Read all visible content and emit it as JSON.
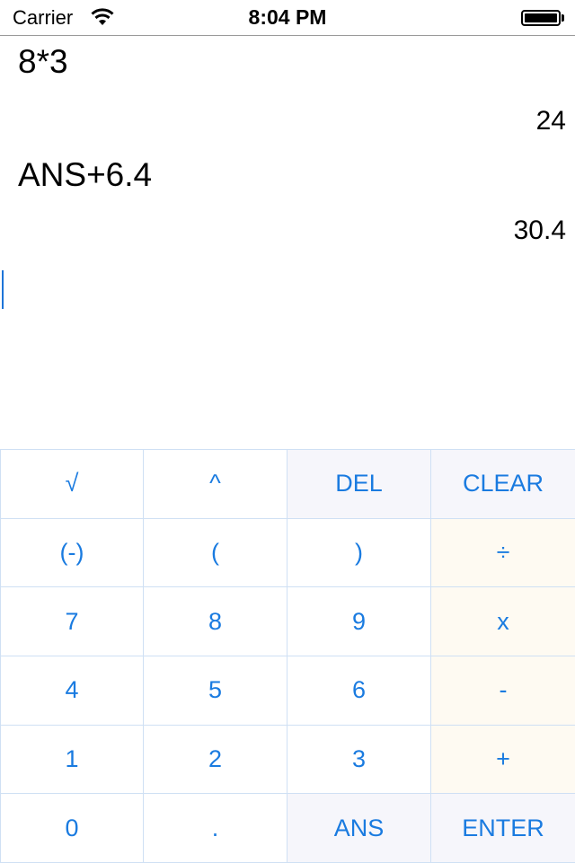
{
  "status_bar": {
    "carrier": "Carrier",
    "time": "8:04 PM",
    "battery_level": 1.0
  },
  "history": [
    {
      "expression": "8*3",
      "result": "24"
    },
    {
      "expression": "ANS+6.4",
      "result": "30.4"
    }
  ],
  "input": {
    "value": ""
  },
  "keypad": {
    "accent_color": "#1a7be0",
    "rows": [
      [
        {
          "label": "√",
          "style": "white"
        },
        {
          "label": "^",
          "style": "white"
        },
        {
          "label": "DEL",
          "style": "gray"
        },
        {
          "label": "CLEAR",
          "style": "gray"
        }
      ],
      [
        {
          "label": "(-)",
          "style": "white"
        },
        {
          "label": "(",
          "style": "white"
        },
        {
          "label": ")",
          "style": "white"
        },
        {
          "label": "÷",
          "style": "cream"
        }
      ],
      [
        {
          "label": "7",
          "style": "white"
        },
        {
          "label": "8",
          "style": "white"
        },
        {
          "label": "9",
          "style": "white"
        },
        {
          "label": "x",
          "style": "cream"
        }
      ],
      [
        {
          "label": "4",
          "style": "white"
        },
        {
          "label": "5",
          "style": "white"
        },
        {
          "label": "6",
          "style": "white"
        },
        {
          "label": "-",
          "style": "cream"
        }
      ],
      [
        {
          "label": "1",
          "style": "white"
        },
        {
          "label": "2",
          "style": "white"
        },
        {
          "label": "3",
          "style": "white"
        },
        {
          "label": "+",
          "style": "cream"
        }
      ],
      [
        {
          "label": "0",
          "style": "white"
        },
        {
          "label": ".",
          "style": "white"
        },
        {
          "label": "ANS",
          "style": "gray"
        },
        {
          "label": "ENTER",
          "style": "gray"
        }
      ]
    ]
  }
}
